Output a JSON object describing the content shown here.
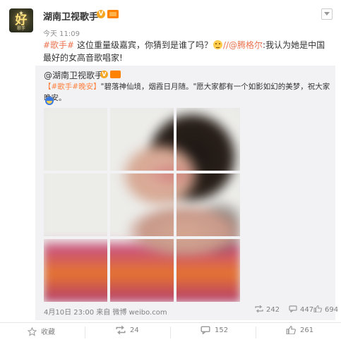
{
  "post": {
    "author": "湖南卫视歌手",
    "avatar_text": "好",
    "avatar_sub": "歌手",
    "verified_badge": "V",
    "time": "今天 11:09",
    "content": {
      "tag": "#歌手#",
      "text1": " 这位重量级嘉宾，你猜到是谁了吗？",
      "mention": "//@腾格尔",
      "text2": ":我认为她是中国最好的女高音歌唱家!"
    }
  },
  "repost": {
    "author_prefix": "@",
    "author": "湖南卫视歌手",
    "verified_badge": "V",
    "text_tags": "【#歌手#晚安】",
    "text_body": "\"碧落神仙境，烟霞日月随。\"愿大家都有一个如影如幻的美梦，祝大家晚安。",
    "meta": "4月10日 23:00 来自 微博 weibo.com",
    "reposts": "242",
    "comments": "447",
    "likes": "694"
  },
  "actions": {
    "favorite": "收藏",
    "repost": "24",
    "comment": "152",
    "like": "261"
  },
  "colors": {
    "accent": "#eb7350",
    "muted": "#808080",
    "panel": "#f2f2f5",
    "vip": "#ff8200"
  },
  "icons": {
    "favorite": "star-icon",
    "repost": "repost-icon",
    "comment": "comment-icon",
    "like": "thumbs-up-icon",
    "menu": "chevron-down-icon"
  }
}
